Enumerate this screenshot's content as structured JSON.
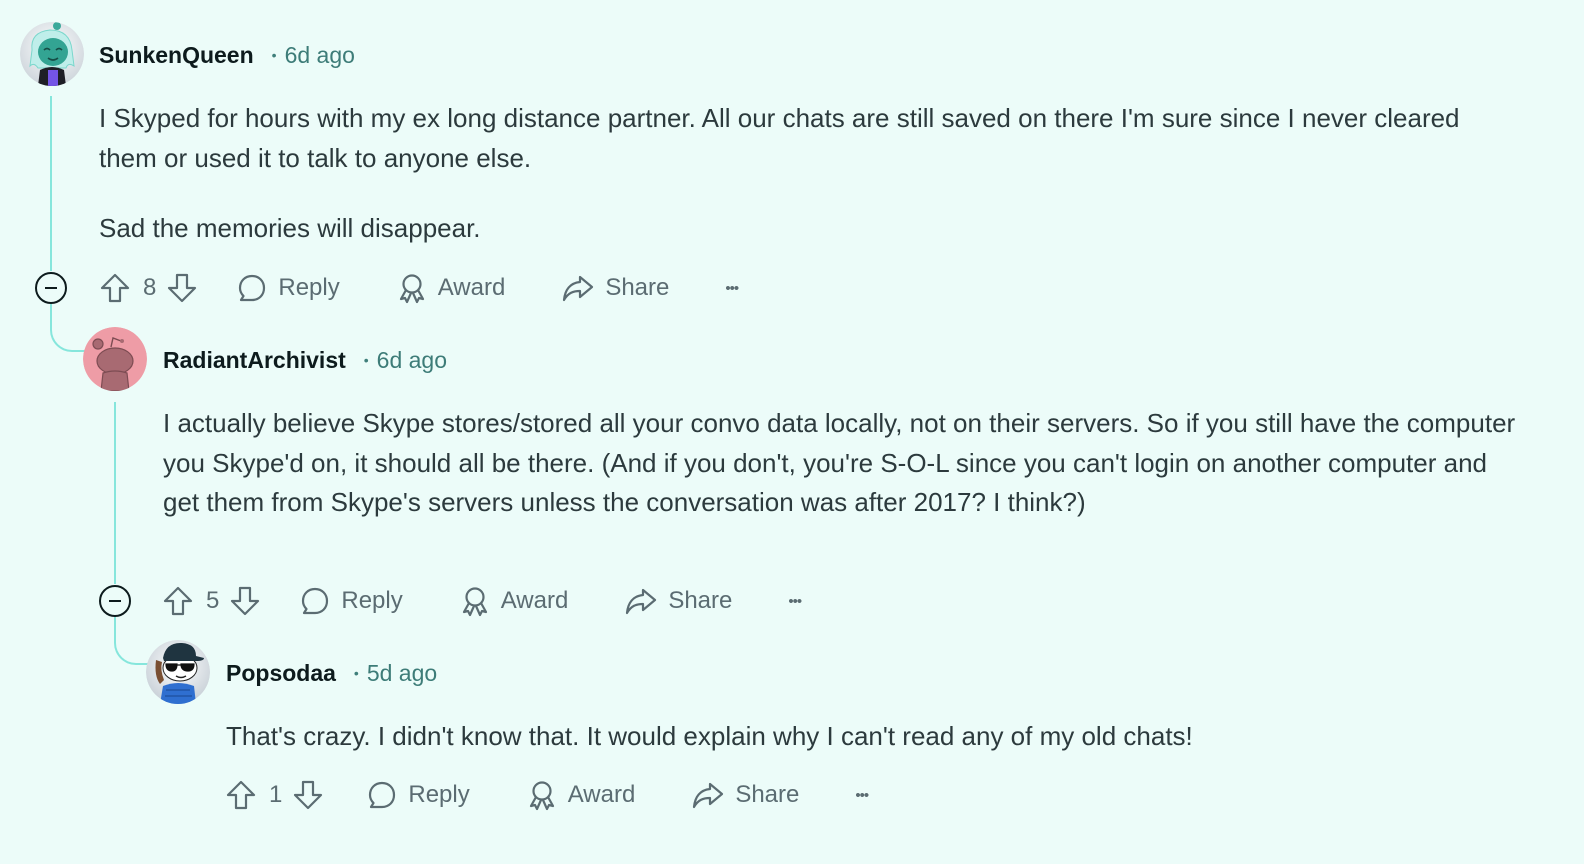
{
  "theme": {
    "background": "#ecfcf9",
    "thread_line": "#86e6dc",
    "username_color": "#0d1b1d",
    "timestamp_color": "#3d7c78",
    "body_color": "#2c3a3d",
    "action_color": "#5b6c72"
  },
  "comments": [
    {
      "username": "SunkenQueen",
      "separator": "•",
      "timestamp": "6d ago",
      "avatar": "avatar-teal-character-icon",
      "paragraphs": [
        "I Skyped for hours with my ex long distance partner. All our chats are still saved on there I'm sure since I never cleared them or used it to talk to anyone else.",
        "Sad the memories will disappear."
      ],
      "score": "8",
      "actions": {
        "reply": "Reply",
        "award": "Award",
        "share": "Share",
        "more": "•••"
      }
    },
    {
      "username": "RadiantArchivist",
      "separator": "•",
      "timestamp": "6d ago",
      "avatar": "avatar-default-snoo-pink-icon",
      "paragraphs": [
        "I actually believe Skype stores/stored all your convo data locally, not on their servers. So if you still have the computer you Skype'd on, it should all be there. (And if you don't, you're S-O-L since you can't login on another computer and get them from Skype's servers unless the conversation was after 2017? I think?)"
      ],
      "score": "5",
      "actions": {
        "reply": "Reply",
        "award": "Award",
        "share": "Share",
        "more": "•••"
      }
    },
    {
      "username": "Popsodaa",
      "separator": "•",
      "timestamp": "5d ago",
      "avatar": "avatar-snoo-cap-sunglasses-icon",
      "paragraphs": [
        "That's crazy. I didn't know that. It would explain why I can't read any of my old chats!"
      ],
      "score": "1",
      "actions": {
        "reply": "Reply",
        "award": "Award",
        "share": "Share",
        "more": "•••"
      }
    }
  ]
}
